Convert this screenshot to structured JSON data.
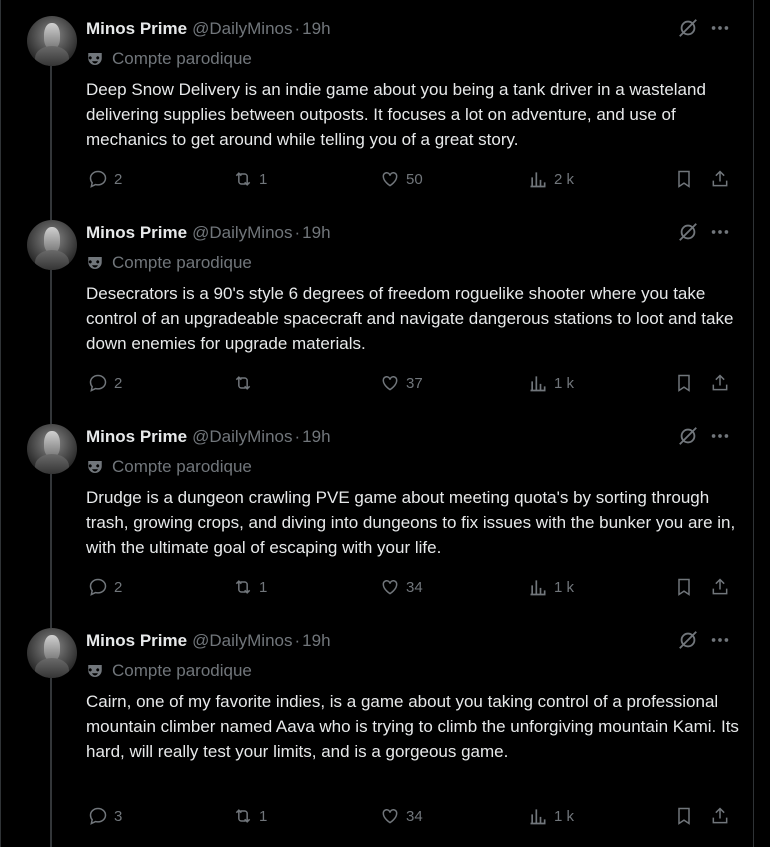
{
  "tweets": [
    {
      "name": "Minos Prime",
      "handle": "@DailyMinos",
      "time": "19h",
      "parody_label": "Compte parodique",
      "text": "Deep Snow Delivery is an indie game about you being a tank driver in a wasteland delivering supplies between outposts. It focuses a lot on adventure, and use of mechanics to get around while telling you of a great story.",
      "replies": "2",
      "retweets": "1",
      "likes": "50",
      "views": "2 k"
    },
    {
      "name": "Minos Prime",
      "handle": "@DailyMinos",
      "time": "19h",
      "parody_label": "Compte parodique",
      "text": "Desecrators is a 90's style 6 degrees of freedom roguelike shooter where you take control of an upgradeable spacecraft and navigate dangerous stations to loot and take down enemies for upgrade materials.",
      "replies": "2",
      "retweets": "",
      "likes": "37",
      "views": "1 k"
    },
    {
      "name": "Minos Prime",
      "handle": "@DailyMinos",
      "time": "19h",
      "parody_label": "Compte parodique",
      "text": "Drudge is a dungeon crawling PVE game about meeting quota's by sorting through trash, growing crops, and diving into dungeons to fix issues with the bunker you are in, with the ultimate goal of escaping with your life.",
      "replies": "2",
      "retweets": "1",
      "likes": "34",
      "views": "1 k"
    },
    {
      "name": "Minos Prime",
      "handle": "@DailyMinos",
      "time": "19h",
      "parody_label": "Compte parodique",
      "text": "Cairn, one of my favorite indies, is a game about you taking control of a professional mountain climber named Aava who is trying to climb the unforgiving mountain Kami. Its hard, will really test your limits, and is a gorgeous game.",
      "replies": "3",
      "retweets": "1",
      "likes": "34",
      "views": "1 k"
    }
  ],
  "theme": {
    "background": "#000000",
    "text": "#e7e9ea",
    "secondary": "#71767b",
    "border": "#2f3336"
  },
  "icons": [
    "avatar",
    "parody-mask-icon",
    "grok-icon",
    "more-icon",
    "reply-icon",
    "retweet-icon",
    "like-icon",
    "views-icon",
    "bookmark-icon",
    "share-icon"
  ]
}
